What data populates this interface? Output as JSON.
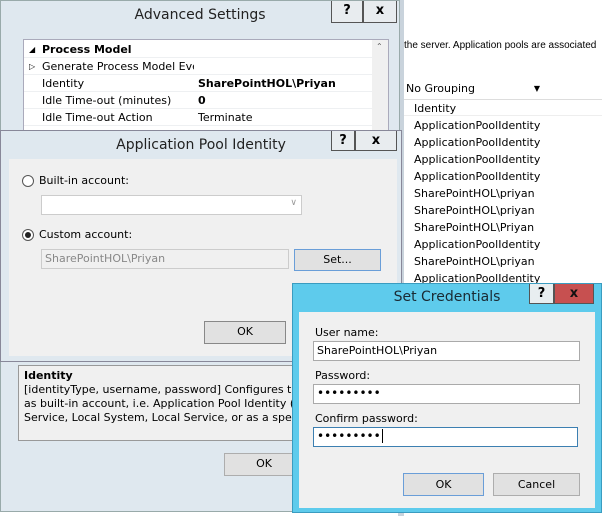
{
  "background": {
    "description_text": "the server. Application pools are associated",
    "grouping": "No Grouping",
    "column_header": "Identity",
    "identities": [
      "ApplicationPoolIdentity",
      "ApplicationPoolIdentity",
      "ApplicationPoolIdentity",
      "ApplicationPoolIdentity",
      "SharePointHOL\\priyan",
      "SharePointHOL\\priyan",
      "SharePointHOL\\Priyan",
      "ApplicationPoolIdentity",
      "SharePointHOL\\priyan",
      "ApplicationPoolIdentity"
    ]
  },
  "advanced_settings": {
    "title": "Advanced Settings",
    "help": "?",
    "close": "x",
    "section": "Process Model",
    "rows": [
      {
        "name": "Generate Process Model Event L",
        "value": ""
      },
      {
        "name": "Identity",
        "value": "SharePointHOL\\Priyan"
      },
      {
        "name": "Idle Time-out (minutes)",
        "value": "0"
      },
      {
        "name": "Idle Time-out Action",
        "value": "Terminate"
      }
    ],
    "desc_title": "Identity",
    "desc_lines": [
      "[identityType, username, password] Configures the applic",
      "as built-in account, i.e. Application Pool Identity (recomm",
      "Service, Local System, Local Service, or as a specific user i"
    ],
    "ok": "OK"
  },
  "app_pool_identity": {
    "title": "Application Pool Identity",
    "help": "?",
    "close": "x",
    "builtin_label": "Built-in account:",
    "builtin_value": "",
    "custom_label": "Custom account:",
    "custom_value": "SharePointHOL\\Priyan",
    "set": "Set...",
    "ok": "OK",
    "selected": "custom"
  },
  "set_credentials": {
    "title": "Set Credentials",
    "help": "?",
    "close": "x",
    "username_label": "User name:",
    "username": "SharePointHOL\\Priyan",
    "password_label": "Password:",
    "password": "•••••••••",
    "confirm_label": "Confirm password:",
    "confirm": "•••••••••",
    "ok": "OK",
    "cancel": "Cancel",
    "accent": "#5ecbec",
    "close_color": "#c75050"
  }
}
